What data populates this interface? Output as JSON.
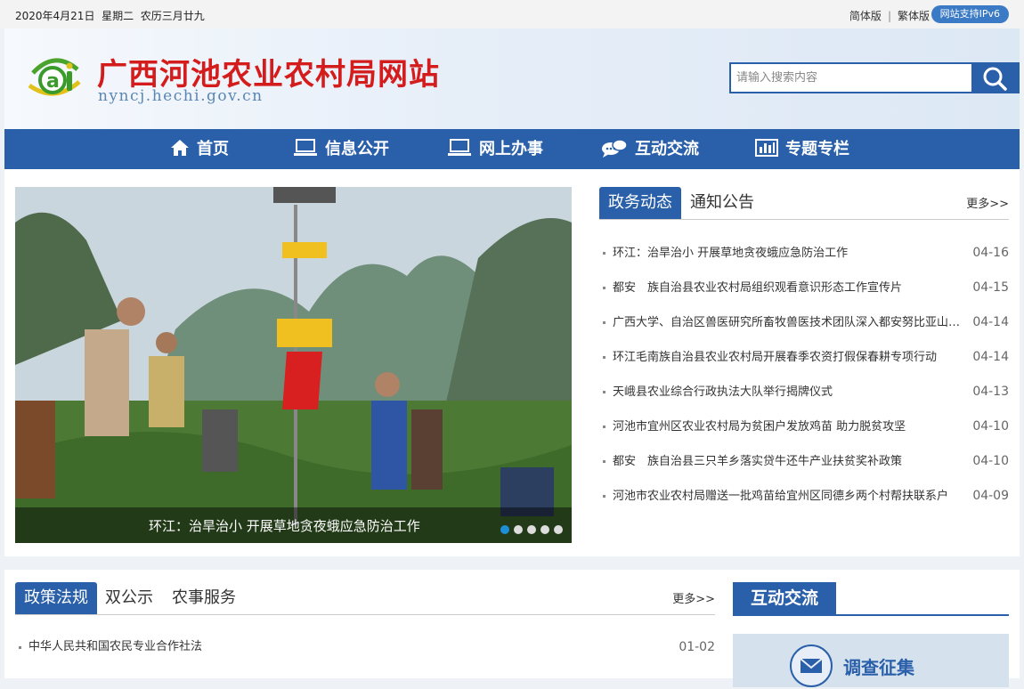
{
  "topbar": {
    "date": "2020年4月21日",
    "weekday": "星期二",
    "lunar": "农历三月廿九",
    "simplified": "简体版",
    "separator": "|",
    "traditional": "繁体版",
    "ipv6": "网站支持IPv6"
  },
  "header": {
    "title": "广西河池农业农村局网站",
    "domain": "nyncj.hechi.gov.cn",
    "logo_icon": "agri-logo-icon",
    "search_placeholder": "请输入搜索内容"
  },
  "nav": {
    "items": [
      {
        "label": "首页",
        "icon": "home-icon"
      },
      {
        "label": "信息公开",
        "icon": "laptop-icon"
      },
      {
        "label": "网上办事",
        "icon": "laptop-icon"
      },
      {
        "label": "互动交流",
        "icon": "chat-bubble-icon"
      },
      {
        "label": "专题专栏",
        "icon": "bar-chart-icon"
      }
    ]
  },
  "slideshow": {
    "caption": "环江：治旱治小 开展草地贪夜蛾应急防治工作",
    "slide_count": 5,
    "active_slide": 1
  },
  "news": {
    "tabs": [
      "政务动态",
      "通知公告"
    ],
    "more": "更多>>",
    "items": [
      {
        "title": "环江：治旱治小 开展草地贪夜蛾应急防治工作",
        "date": "04-16"
      },
      {
        "title": "都安　族自治县农业农村局组织观看意识形态工作宣传片",
        "date": "04-15"
      },
      {
        "title": "广西大学、自治区兽医研究所畜牧兽医技术团队深入都安努比亚山羊养殖基地开展调研",
        "date": "04-14"
      },
      {
        "title": "环江毛南族自治县农业农村局开展春季农资打假保春耕专项行动",
        "date": "04-14"
      },
      {
        "title": "天峨县农业综合行政执法大队举行揭牌仪式",
        "date": "04-13"
      },
      {
        "title": "河池市宜州区农业农村局为贫困户发放鸡苗 助力脱贫攻坚",
        "date": "04-10"
      },
      {
        "title": "都安　族自治县三只羊乡落实贷牛还牛产业扶贫奖补政策",
        "date": "04-10"
      },
      {
        "title": "河池市农业农村局赠送一批鸡苗给宜州区同德乡两个村帮扶联系户",
        "date": "04-09"
      }
    ]
  },
  "policy": {
    "tabs": [
      "政策法规",
      "双公示",
      "农事服务"
    ],
    "more": "更多>>",
    "items": [
      {
        "title": "中华人民共和国农民专业合作社法",
        "date": "01-02"
      }
    ]
  },
  "interact": {
    "title": "互动交流",
    "survey": "调查征集",
    "survey_icon": "envelope-icon"
  },
  "colors": {
    "primary": "#2a5fa9",
    "title_red": "#d41c1c",
    "dot_active": "#1e8fd6"
  }
}
